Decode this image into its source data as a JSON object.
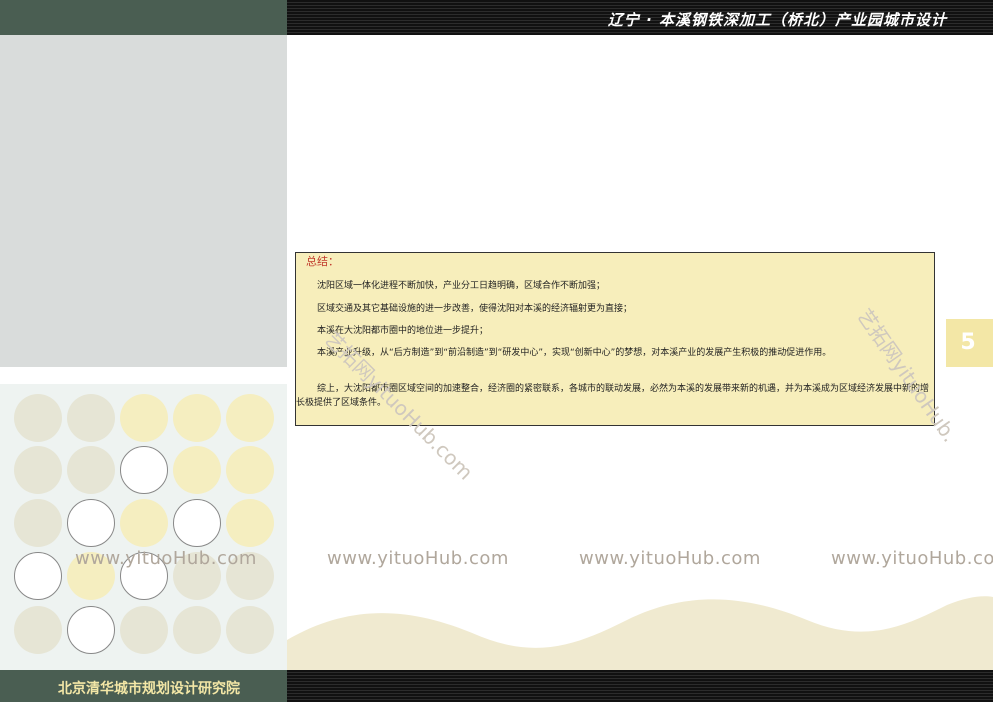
{
  "header": {
    "title": "辽宁 · 本溪钢铁深加工（桥北）产业园城市设计"
  },
  "summary": {
    "title": "总结：",
    "paragraphs": [
      "沈阳区域一体化进程不断加快，产业分工日趋明确，区域合作不断加强；",
      "区域交通及其它基础设施的进一步改善，使得沈阳对本溪的经济辐射更为直接；",
      "本溪在大沈阳都市圈中的地位进一步提升；",
      "本溪产业升级，从“后方制造”到“前沿制造”到“研发中心”，实现“创新中心”的梦想，对本溪产业的发展产生积极的推动促进作用。",
      "综上，大沈阳都市圈区域空间的加速整合，经济圈的紧密联系，各城市的联动发展，必然为本溪的发展带来新的机遇，并为本溪成为区域经济发展中新的增长极提供了区域条件。"
    ]
  },
  "page": {
    "number": "5"
  },
  "footer": {
    "org": "北京清华城市规划设计研究院"
  },
  "watermarks": {
    "text": "www.yituoHub.com",
    "diag_left": "艺拓网yituoHub.com",
    "diag_right": "艺拓网yituoHub."
  },
  "colors": {
    "header_green": "#4a5e52",
    "summary_bg": "#f7eebb",
    "accent_yellow": "#f3e7a6",
    "dot_gray": "#e6e5d5",
    "dot_yellow": "#f5eec0",
    "dot_outline": "#888888"
  }
}
